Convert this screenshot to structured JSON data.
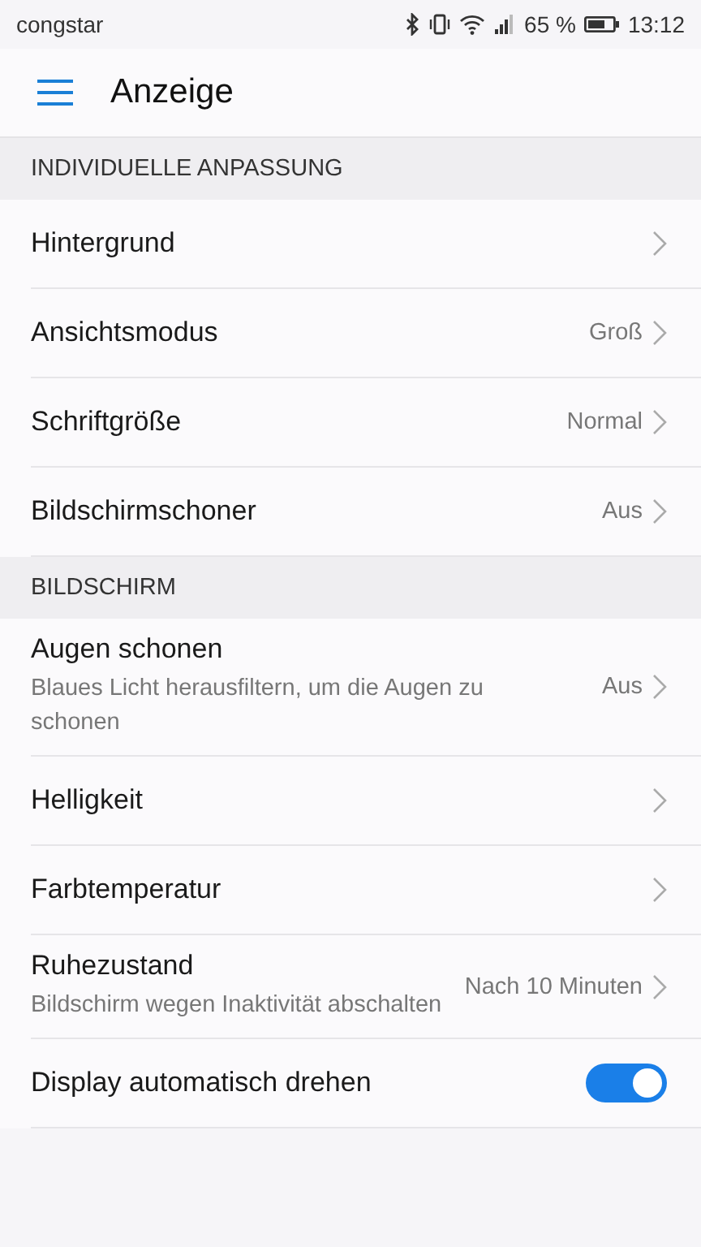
{
  "status_bar": {
    "carrier": "congstar",
    "battery": "65 %",
    "time": "13:12"
  },
  "header": {
    "title": "Anzeige"
  },
  "sections": [
    {
      "title": "INDIVIDUELLE ANPASSUNG",
      "items": [
        {
          "kind": "link",
          "label": "Hintergrund"
        },
        {
          "kind": "link",
          "label": "Ansichtsmodus",
          "value": "Groß"
        },
        {
          "kind": "link",
          "label": "Schriftgröße",
          "value": "Normal"
        },
        {
          "kind": "link",
          "label": "Bildschirmschoner",
          "value": "Aus"
        }
      ]
    },
    {
      "title": "BILDSCHIRM",
      "items": [
        {
          "kind": "link",
          "label": "Augen schonen",
          "subtitle": "Blaues Licht herausfiltern, um die Augen zu schonen",
          "value": "Aus"
        },
        {
          "kind": "link",
          "label": "Helligkeit"
        },
        {
          "kind": "link",
          "label": "Farbtemperatur"
        },
        {
          "kind": "link",
          "label": "Ruhezustand",
          "subtitle": "Bildschirm wegen Inaktivität abschalten",
          "value": "Nach 10 Minuten"
        },
        {
          "kind": "toggle",
          "label": "Display automatisch drehen",
          "on": true
        }
      ]
    }
  ]
}
